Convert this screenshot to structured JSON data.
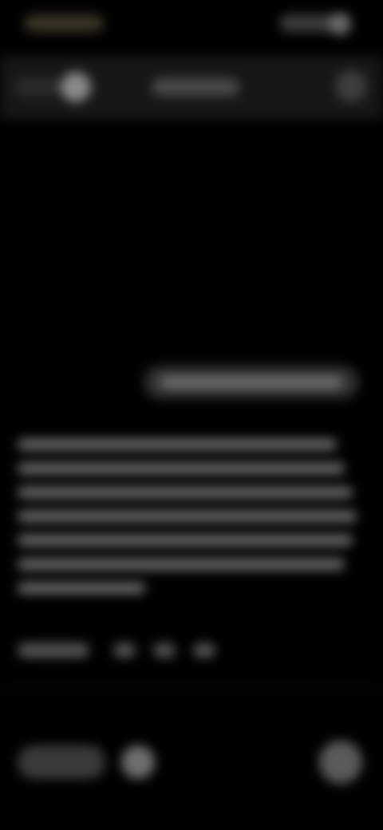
{
  "theme": {
    "background": "#000000",
    "surface": "#161616",
    "bubble": "#2e2e2e",
    "text_placeholder": "#6b6b6b"
  },
  "status_bar": {
    "icons": [
      "signal-icon",
      "battery-icon"
    ]
  },
  "header": {
    "icons": [
      "back-icon",
      "avatar-icon",
      "menu-icon"
    ]
  },
  "conversation": {
    "user_message_lines": 1,
    "response_lines": 7
  },
  "actions": {
    "icons": [
      "copy-icon",
      "thumbs-up-icon",
      "thumbs-down-icon",
      "share-icon"
    ]
  },
  "composer": {
    "icons": [
      "attach-icon",
      "voice-icon",
      "send-icon"
    ]
  }
}
